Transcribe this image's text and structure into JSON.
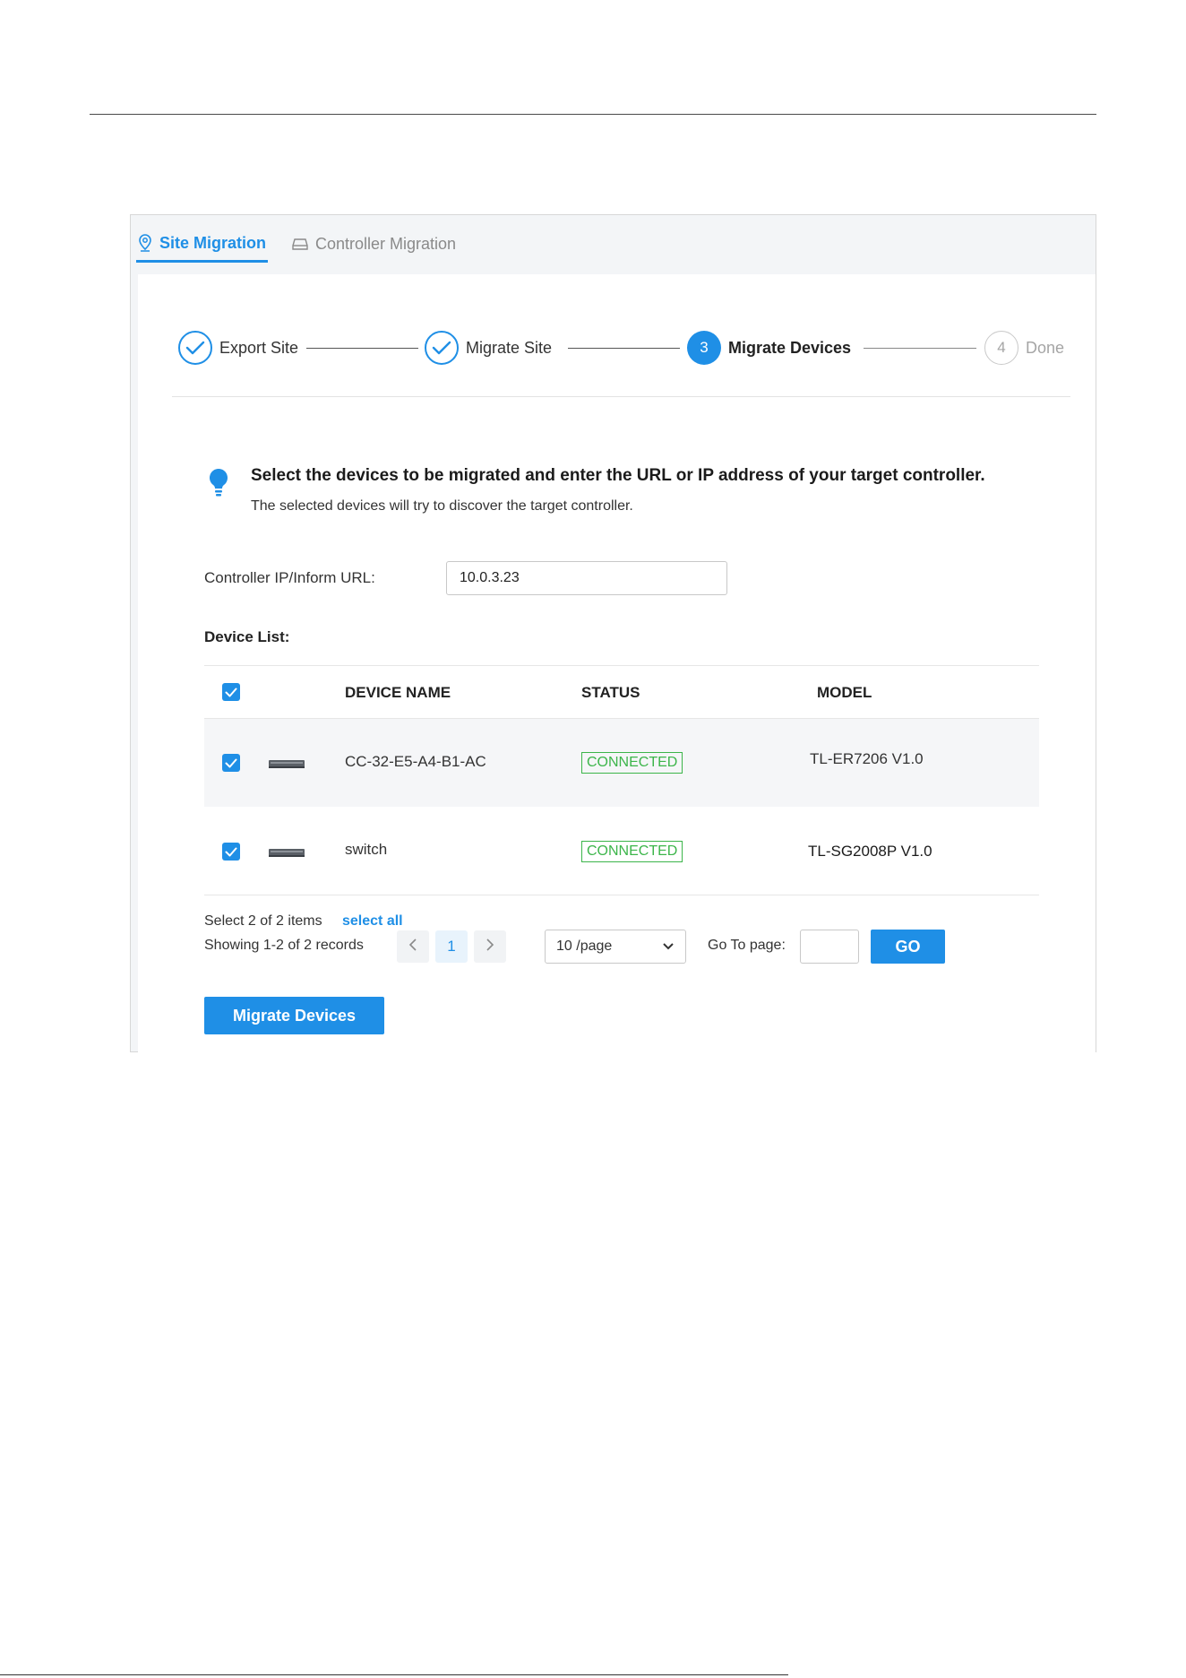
{
  "tabs": [
    {
      "label": "Site Migration",
      "icon": "location-pin-icon",
      "active": true
    },
    {
      "label": "Controller Migration",
      "icon": "device-icon",
      "active": false
    }
  ],
  "stepper": [
    {
      "label": "Export Site",
      "state": "done",
      "number": ""
    },
    {
      "label": "Migrate Site",
      "state": "done",
      "number": ""
    },
    {
      "label": "Migrate Devices",
      "state": "active",
      "number": "3"
    },
    {
      "label": "Done",
      "state": "todo",
      "number": "4"
    }
  ],
  "notice": {
    "title": "Select the devices to be migrated and enter the URL or IP address of your target controller.",
    "subtitle": "The selected devices will try to discover the target controller."
  },
  "controller": {
    "label": "Controller IP/Inform URL:",
    "value": "10.0.3.23"
  },
  "device_list": {
    "label": "Device List:",
    "columns": [
      "DEVICE NAME",
      "STATUS",
      "MODEL"
    ],
    "rows": [
      {
        "name": "CC-32-E5-A4-B1-AC",
        "status": "CONNECTED",
        "model": "TL-ER7206 V1.0",
        "checked": true
      },
      {
        "name": "switch",
        "status": "CONNECTED",
        "model": "TL-SG2008P V1.0",
        "checked": true
      }
    ]
  },
  "pagination": {
    "selected_text": "Select 2 of 2 items",
    "select_all": "select all",
    "showing": "Showing 1-2 of 2 records",
    "current_page": "1",
    "per_page": "10 /page",
    "goto_label": "Go To page:",
    "go": "GO"
  },
  "migrate_button": "Migrate Devices",
  "colors": {
    "accent": "#1f8fe6",
    "connected": "#3cb54a"
  }
}
